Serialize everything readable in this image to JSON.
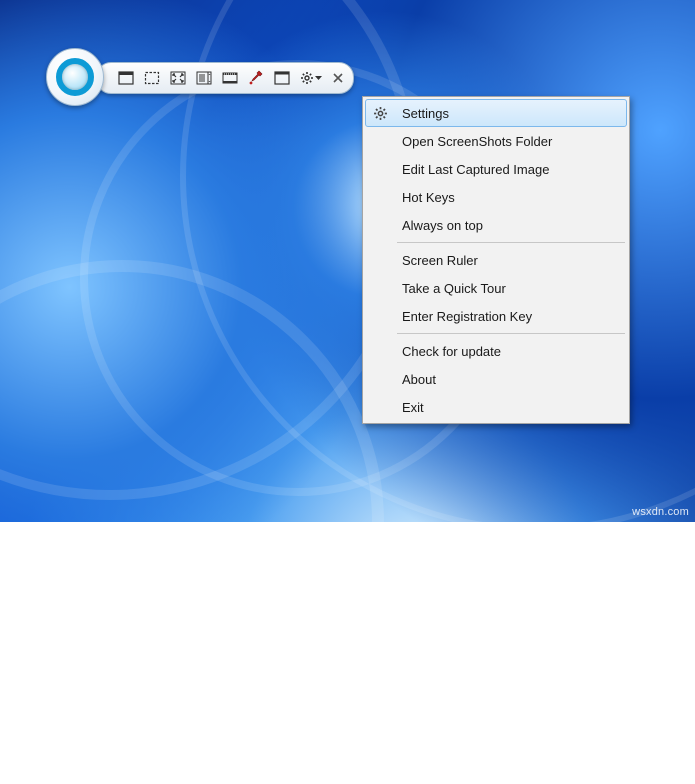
{
  "toolbar": {
    "buttons": [
      {
        "name": "capture-window-icon",
        "title": "Capture Window"
      },
      {
        "name": "capture-region-icon",
        "title": "Capture Region"
      },
      {
        "name": "capture-fullscreen-icon",
        "title": "Capture Full Screen"
      },
      {
        "name": "capture-scrolling-icon",
        "title": "Scrolling Capture"
      },
      {
        "name": "record-video-icon",
        "title": "Screen Recorder"
      },
      {
        "name": "color-picker-icon",
        "title": "Color Picker"
      },
      {
        "name": "open-folder-icon",
        "title": "Open Folder"
      },
      {
        "name": "settings-gear-icon",
        "title": "Settings"
      }
    ],
    "close_title": "Close"
  },
  "menu": {
    "groups": [
      [
        {
          "label": "Settings",
          "highlighted": true,
          "icon": "gear-icon"
        },
        {
          "label": "Open ScreenShots Folder"
        },
        {
          "label": "Edit Last Captured Image"
        },
        {
          "label": "Hot Keys"
        },
        {
          "label": "Always on top"
        }
      ],
      [
        {
          "label": "Screen Ruler"
        },
        {
          "label": "Take a Quick Tour"
        },
        {
          "label": "Enter Registration Key"
        }
      ],
      [
        {
          "label": "Check for update"
        },
        {
          "label": "About"
        },
        {
          "label": "Exit"
        }
      ]
    ]
  },
  "watermark": "wsxdn.com"
}
